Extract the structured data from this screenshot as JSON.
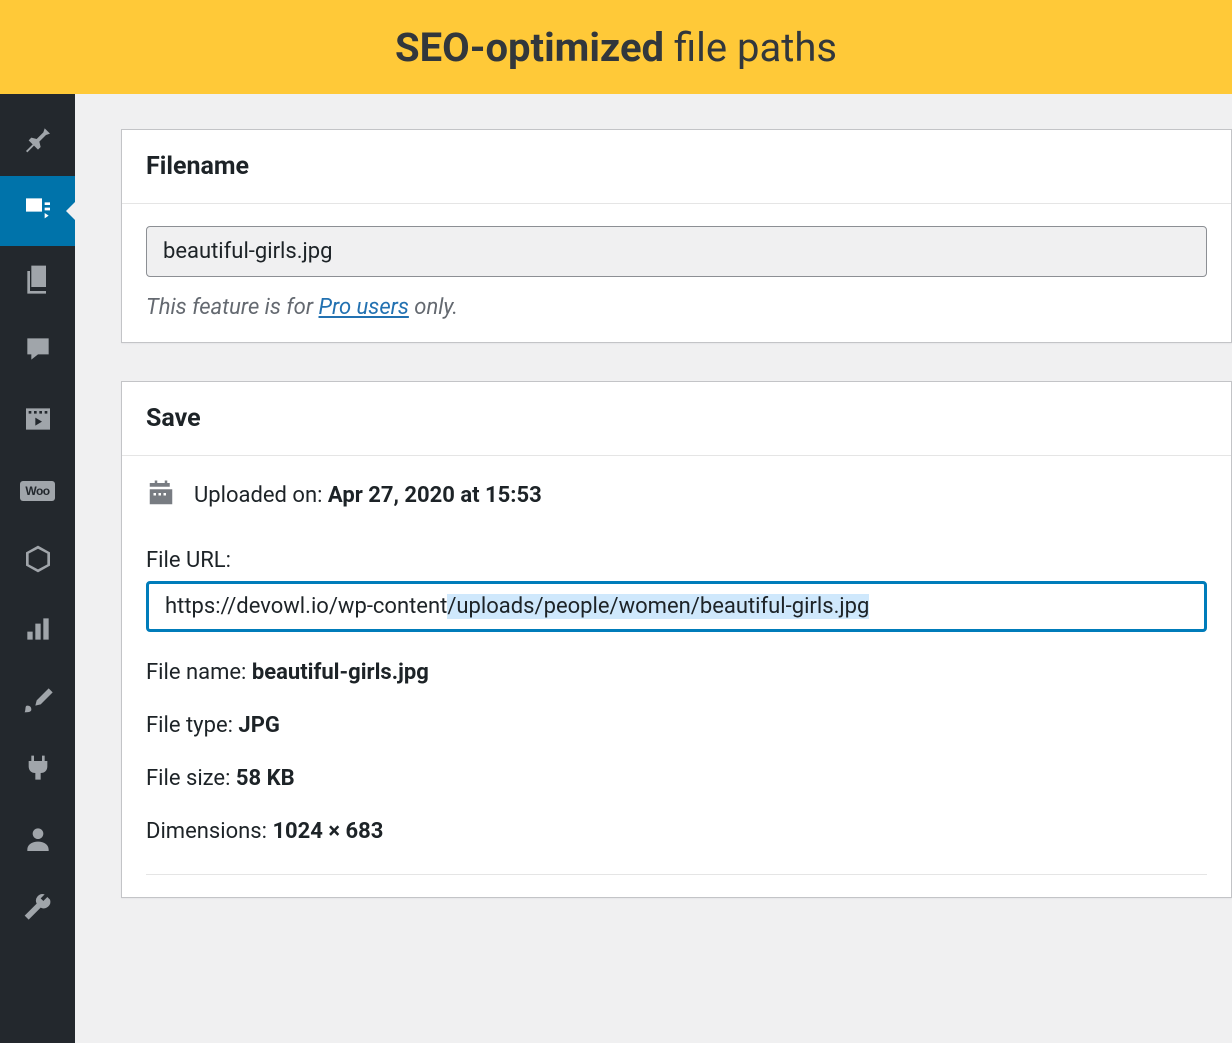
{
  "banner": {
    "bold": "SEO-optimized",
    "rest": " file paths"
  },
  "sidebar": [
    {
      "name": "pin-icon"
    },
    {
      "name": "media-icon",
      "active": true
    },
    {
      "name": "pages-icon"
    },
    {
      "name": "comments-icon"
    },
    {
      "name": "video-post-icon"
    },
    {
      "name": "woocommerce-icon",
      "badge": "Woo"
    },
    {
      "name": "products-icon"
    },
    {
      "name": "analytics-icon"
    },
    {
      "name": "appearance-icon"
    },
    {
      "name": "plugins-icon"
    },
    {
      "name": "users-icon"
    },
    {
      "name": "tools-icon"
    }
  ],
  "filename_panel": {
    "title": "Filename",
    "value": "beautiful-girls.jpg",
    "hint_before": "This feature is for ",
    "hint_link": "Pro users",
    "hint_after": " only."
  },
  "save_panel": {
    "title": "Save",
    "uploaded_label": "Uploaded on: ",
    "uploaded_date": "Apr 27, 2020 at 15:53",
    "file_url_label": "File URL:",
    "file_url_plain": "https://devowl.io/wp-content",
    "file_url_highlighted": "/uploads/people/women/beautiful-girls.jpg",
    "rows": {
      "filename_label": "File name: ",
      "filename_value": "beautiful-girls.jpg",
      "filetype_label": "File type: ",
      "filetype_value": "JPG",
      "filesize_label": "File size: ",
      "filesize_value": "58 KB",
      "dimensions_label": "Dimensions: ",
      "dimensions_value": "1024 × 683"
    }
  }
}
